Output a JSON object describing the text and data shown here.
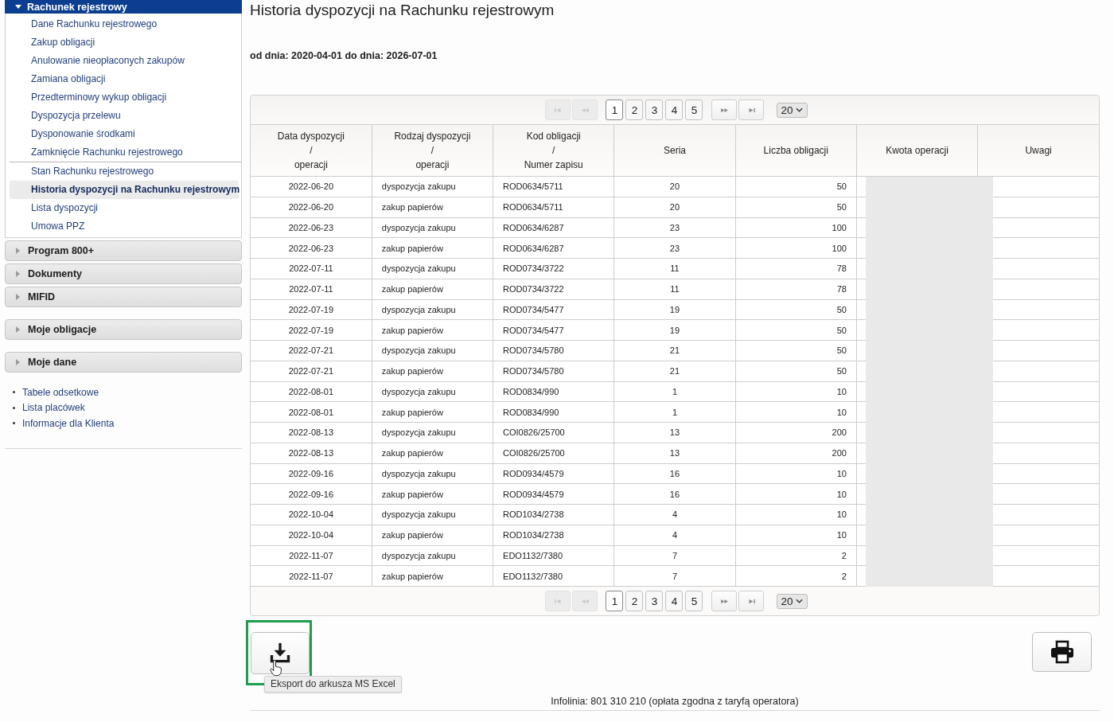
{
  "sidebar": {
    "panel_groups": [
      [
        {
          "title": "Rachunek rejestrowy",
          "expanded": true,
          "item_groups": [
            [
              {
                "label": "Dane Rachunku rejestrowego",
                "selected": false
              },
              {
                "label": "Zakup obligacji",
                "selected": false
              },
              {
                "label": "Anulowanie nieopłaconych zakupów",
                "selected": false
              },
              {
                "label": "Zamiana obligacji",
                "selected": false
              },
              {
                "label": "Przedterminowy wykup obligacji",
                "selected": false
              },
              {
                "label": "Dyspozycja przelewu",
                "selected": false
              },
              {
                "label": "Dysponowanie środkami",
                "selected": false
              },
              {
                "label": "Zamknięcie Rachunku rejestrowego",
                "selected": false
              }
            ],
            [
              {
                "label": "Stan Rachunku rejestrowego",
                "selected": false
              },
              {
                "label": "Historia dyspozycji na Rachunku rejestrowym",
                "selected": true
              },
              {
                "label": "Lista dyspozycji",
                "selected": false
              },
              {
                "label": "Umowa PPZ",
                "selected": false
              }
            ]
          ]
        },
        {
          "title": "Program 800+",
          "expanded": false
        },
        {
          "title": "Dokumenty",
          "expanded": false
        },
        {
          "title": "MIFID",
          "expanded": false
        }
      ],
      [
        {
          "title": "Moje obligacje",
          "expanded": false
        }
      ],
      [
        {
          "title": "Moje dane",
          "expanded": false
        }
      ]
    ],
    "links": [
      "Tabele odsetkowe",
      "Lista placówek",
      "Informacje dla Klienta"
    ]
  },
  "main": {
    "title": "Historia dyspozycji na Rachunku rejestrowym",
    "date_range": "od dnia: 2020-04-01 do dnia: 2026-07-01",
    "table": {
      "pagination_top": {
        "nav_back": [
          {
            "kind": "first",
            "disabled": true
          },
          {
            "kind": "prev",
            "disabled": true
          }
        ],
        "pages": [
          {
            "label": "1",
            "selected": true
          },
          {
            "label": "2",
            "selected": false
          },
          {
            "label": "3",
            "selected": false
          },
          {
            "label": "4",
            "selected": false
          },
          {
            "label": "5",
            "selected": false
          }
        ],
        "nav_forward": [
          {
            "kind": "next",
            "disabled": false
          },
          {
            "kind": "last",
            "disabled": false
          }
        ],
        "page_size": "20"
      },
      "columns": [
        {
          "lines": [
            "Data dyspozycji",
            "/",
            "operacji"
          ]
        },
        {
          "lines": [
            "Rodzaj dyspozycji",
            "/",
            "operacji"
          ]
        },
        {
          "lines": [
            "Kod obligacji",
            "/",
            "Numer zapisu"
          ]
        },
        {
          "lines": [
            "Seria"
          ]
        },
        {
          "lines": [
            "Liczba obligacji"
          ]
        },
        {
          "lines": [
            "Kwota operacji"
          ]
        },
        {
          "lines": [
            "Uwagi"
          ]
        }
      ],
      "rows": [
        [
          "2022-06-20",
          "dyspozycja zakupu",
          "ROD0634/5711",
          "20",
          "50"
        ],
        [
          "2022-06-20",
          "zakup papierów",
          "ROD0634/5711",
          "20",
          "50"
        ],
        [
          "2022-06-23",
          "dyspozycja zakupu",
          "ROD0634/6287",
          "23",
          "100"
        ],
        [
          "2022-06-23",
          "zakup papierów",
          "ROD0634/6287",
          "23",
          "100"
        ],
        [
          "2022-07-11",
          "dyspozycja zakupu",
          "ROD0734/3722",
          "11",
          "78"
        ],
        [
          "2022-07-11",
          "zakup papierów",
          "ROD0734/3722",
          "11",
          "78"
        ],
        [
          "2022-07-19",
          "dyspozycja zakupu",
          "ROD0734/5477",
          "19",
          "50"
        ],
        [
          "2022-07-19",
          "zakup papierów",
          "ROD0734/5477",
          "19",
          "50"
        ],
        [
          "2022-07-21",
          "dyspozycja zakupu",
          "ROD0734/5780",
          "21",
          "50"
        ],
        [
          "2022-07-21",
          "zakup papierów",
          "ROD0734/5780",
          "21",
          "50"
        ],
        [
          "2022-08-01",
          "dyspozycja zakupu",
          "ROD0834/990",
          "1",
          "10"
        ],
        [
          "2022-08-01",
          "zakup papierów",
          "ROD0834/990",
          "1",
          "10"
        ],
        [
          "2022-08-13",
          "dyspozycja zakupu",
          "COI0826/25700",
          "13",
          "200"
        ],
        [
          "2022-08-13",
          "zakup papierów",
          "COI0826/25700",
          "13",
          "200"
        ],
        [
          "2022-09-16",
          "dyspozycja zakupu",
          "ROD0934/4579",
          "16",
          "10"
        ],
        [
          "2022-09-16",
          "zakup papierów",
          "ROD0934/4579",
          "16",
          "10"
        ],
        [
          "2022-10-04",
          "dyspozycja zakupu",
          "ROD1034/2738",
          "4",
          "10"
        ],
        [
          "2022-10-04",
          "zakup papierów",
          "ROD1034/2738",
          "4",
          "10"
        ],
        [
          "2022-11-07",
          "dyspozycja zakupu",
          "EDO1132/7380",
          "7",
          "2"
        ],
        [
          "2022-11-07",
          "zakup papierów",
          "EDO1132/7380",
          "7",
          "2"
        ]
      ],
      "amount_redacted": true,
      "pagination_bottom": {
        "nav_back": [
          {
            "kind": "first",
            "disabled": true
          },
          {
            "kind": "prev",
            "disabled": true
          }
        ],
        "pages": [
          {
            "label": "1",
            "selected": true
          },
          {
            "label": "2",
            "selected": false
          },
          {
            "label": "3",
            "selected": false
          },
          {
            "label": "4",
            "selected": false
          },
          {
            "label": "5",
            "selected": false
          }
        ],
        "nav_forward": [
          {
            "kind": "next",
            "disabled": false
          },
          {
            "kind": "last",
            "disabled": false
          }
        ],
        "page_size": "20"
      }
    },
    "export": {
      "tooltip": "Eksport do arkusza MS Excel",
      "highlighted": true
    },
    "footer": "Infolinia: 801 310 210 (opłata zgodna z taryfą operatora)"
  }
}
